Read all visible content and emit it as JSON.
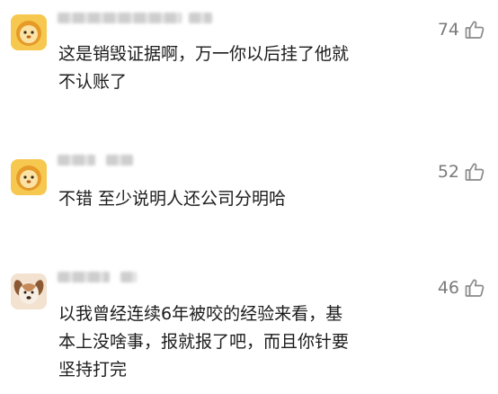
{
  "comments": [
    {
      "text": "这是销毁证据啊，万一你以后挂了他就\n不认账了",
      "likes": "74",
      "avatar": "orange-lion-avatar"
    },
    {
      "text": "不错 至少说明人还公司分明哈",
      "likes": "52",
      "avatar": "orange-lion-avatar"
    },
    {
      "text": "以我曾经连续6年被咬的经验来看，基\n本上没啥事，报就报了吧，而且你针要\n坚持打完",
      "likes": "46",
      "avatar": "dog-avatar"
    }
  ],
  "icons": {
    "like": "thumbs-up-icon"
  },
  "colors": {
    "like_count": "#7a7a7a",
    "text": "#1c1c1c",
    "lion_bg": "#f6c24a",
    "dog_bg": "#f2e2cf"
  }
}
